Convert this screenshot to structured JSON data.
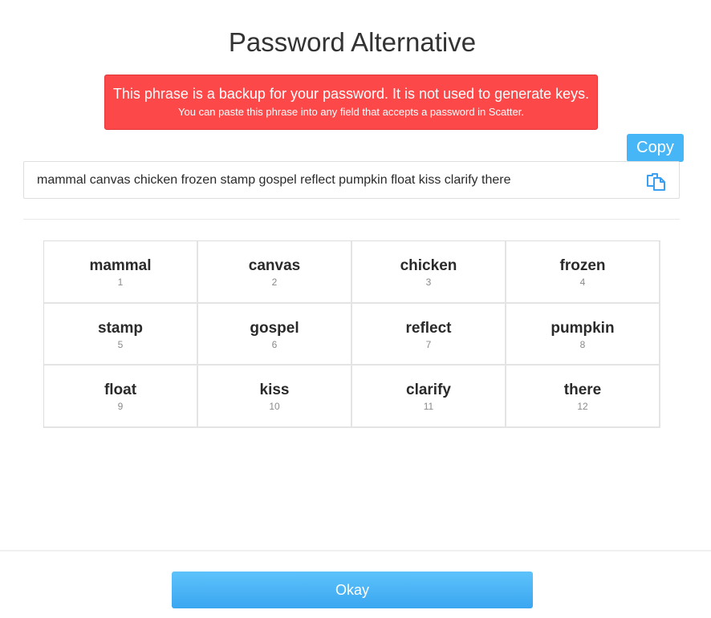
{
  "header": {
    "title": "Password Alternative"
  },
  "warning": {
    "line1": "This phrase is a backup for your password. It is not used to generate keys.",
    "line2": "You can paste this phrase into any field that accepts a password in Scatter."
  },
  "phrase": {
    "copy_label": "Copy",
    "text": "mammal canvas chicken frozen stamp gospel reflect pumpkin float kiss clarify there",
    "copy_icon": "copy-icon"
  },
  "words": [
    {
      "word": "mammal",
      "index": "1"
    },
    {
      "word": "canvas",
      "index": "2"
    },
    {
      "word": "chicken",
      "index": "3"
    },
    {
      "word": "frozen",
      "index": "4"
    },
    {
      "word": "stamp",
      "index": "5"
    },
    {
      "word": "gospel",
      "index": "6"
    },
    {
      "word": "reflect",
      "index": "7"
    },
    {
      "word": "pumpkin",
      "index": "8"
    },
    {
      "word": "float",
      "index": "9"
    },
    {
      "word": "kiss",
      "index": "10"
    },
    {
      "word": "clarify",
      "index": "11"
    },
    {
      "word": "there",
      "index": "12"
    }
  ],
  "footer": {
    "okay_label": "Okay"
  },
  "colors": {
    "warning_bg": "#fd4849",
    "accent": "#46b6f6"
  }
}
